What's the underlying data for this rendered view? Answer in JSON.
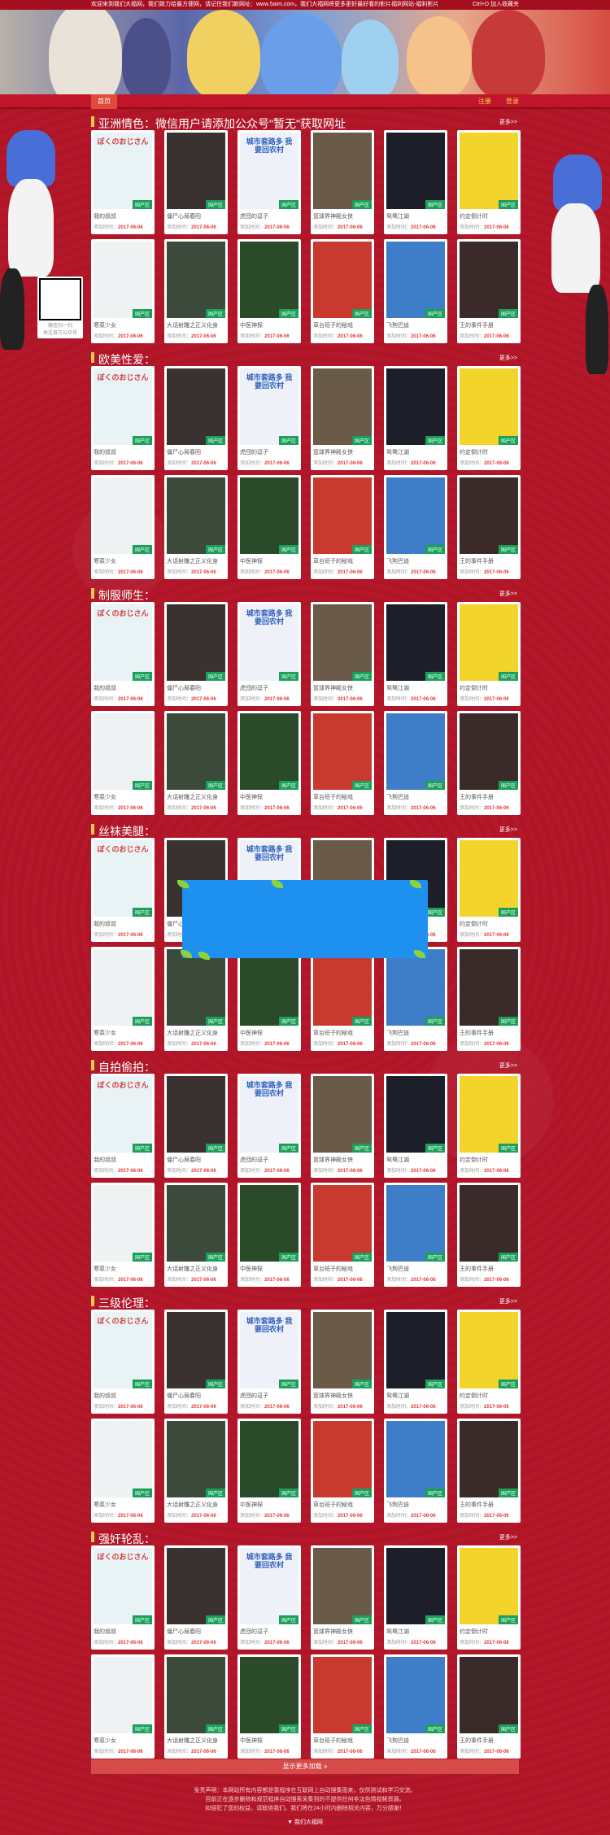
{
  "topbar": {
    "welcome": "欢迎来到我们大福网，我们致力给最方便网，请记住我们新网址：www.5aim.com，我们大福网将更多更好最好看的影片福利网站-福利影片",
    "bookmark": "Ctrl+D 加入收藏夹"
  },
  "nav": {
    "home": "首页",
    "register": "注册",
    "login": "登录"
  },
  "qr": {
    "line1": "微信扫一扫",
    "line2": "关注官方公众号"
  },
  "more_label": "更多>>",
  "date_label": "添加时间：",
  "badge": "国产区",
  "ad_label": "",
  "sections": [
    {
      "title": "亚洲情色：微信用户请添加公众号\"暂无\"获取网址"
    },
    {
      "title": "欧美性爱："
    },
    {
      "title": "制服师生："
    },
    {
      "title": "丝袜美腿："
    },
    {
      "title": "自拍偷拍："
    },
    {
      "title": "三级伦理："
    },
    {
      "title": "强奸轮乱："
    }
  ],
  "movies": [
    {
      "name": "我的叔叔",
      "date": "2017-06-06",
      "bg": "#e9f2f5",
      "fg": "#d23c3c",
      "poster": "ぼくのおじさん"
    },
    {
      "name": "僵尸心局春阳",
      "date": "2017-06-06",
      "bg": "#3a3230",
      "fg": "#d8c6a8",
      "poster": ""
    },
    {
      "name": "虎団的逗子",
      "date": "2017-06-06",
      "bg": "#eef1f8",
      "fg": "#2d5fbf",
      "poster": "城市套路多 我要回农村"
    },
    {
      "name": "篮球界神殿女侠",
      "date": "2017-06-06",
      "bg": "#6a5a48",
      "fg": "#f0d6a0",
      "poster": ""
    },
    {
      "name": "鸳鸯江湖",
      "date": "2017-06-06",
      "bg": "#1c1e2a",
      "fg": "#f3c21f",
      "poster": ""
    },
    {
      "name": "约定倒计时",
      "date": "2017-06-06",
      "bg": "#f3d42a",
      "fg": "#d23c3c",
      "poster": ""
    },
    {
      "name": "寒菜少女",
      "date": "2017-06-06",
      "bg": "#eef2f2",
      "fg": "#2a6060",
      "poster": ""
    },
    {
      "name": "大话射雕之正义化身",
      "date": "2017-06-06",
      "bg": "#3b4a3a",
      "fg": "#e8e0c8",
      "poster": ""
    },
    {
      "name": "中医神探",
      "date": "2017-06-06",
      "bg": "#2a4a2a",
      "fg": "#f0e6a0",
      "poster": ""
    },
    {
      "name": "草台班子的秘戏",
      "date": "2017-06-06",
      "bg": "#c83a30",
      "fg": "#f7e38a",
      "poster": ""
    },
    {
      "name": "飞狗巴迪",
      "date": "2017-06-06",
      "bg": "#3e7ec8",
      "fg": "#f7e02a",
      "poster": ""
    },
    {
      "name": "王的事件手册",
      "date": "2017-06-06",
      "bg": "#3a2a2a",
      "fg": "#e6c07a",
      "poster": ""
    }
  ],
  "load_more": "显示更多加载 »",
  "footer": {
    "line1": "免责声明：本网站所有内容都是靠程序在互联网上自动搜集而来，仅供测试和学习交流。",
    "line2": "目前正在逐步删除和规范程序自动搜索采集到的不提供任何非法色情视频资源。",
    "line3": "如侵犯了您的权益，请联络我们，我们将在24小时内删除相关内容，万分感谢！",
    "brand": "▼ 我们大福网"
  }
}
